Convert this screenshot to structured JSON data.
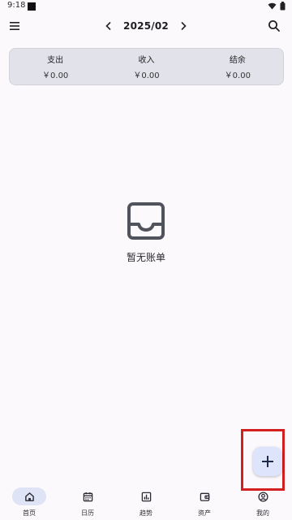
{
  "status_bar": {
    "time": "9:18"
  },
  "header": {
    "month": "2025/02",
    "menu_icon": "hamburger-menu-icon",
    "search_icon": "search-icon",
    "prev_icon": "chevron-left-icon",
    "next_icon": "chevron-right-icon"
  },
  "summary": {
    "expense_label": "支出",
    "expense_value": "￥0.00",
    "income_label": "收入",
    "income_value": "￥0.00",
    "balance_label": "结余",
    "balance_value": "￥0.00"
  },
  "empty": {
    "icon": "inbox-icon",
    "text": "暂无账单"
  },
  "fab": {
    "icon": "plus-icon"
  },
  "bottom_nav": [
    {
      "label": "首页",
      "icon": "home-icon",
      "active": true
    },
    {
      "label": "日历",
      "icon": "calendar-icon"
    },
    {
      "label": "趋势",
      "icon": "chart-icon"
    },
    {
      "label": "资产",
      "icon": "wallet-icon"
    },
    {
      "label": "我的",
      "icon": "profile-icon"
    }
  ],
  "colors": {
    "accent": "#dde4fb",
    "highlight_border": "#d21f1f",
    "card": "#e2e3ea",
    "background": "#fcf9fd"
  }
}
